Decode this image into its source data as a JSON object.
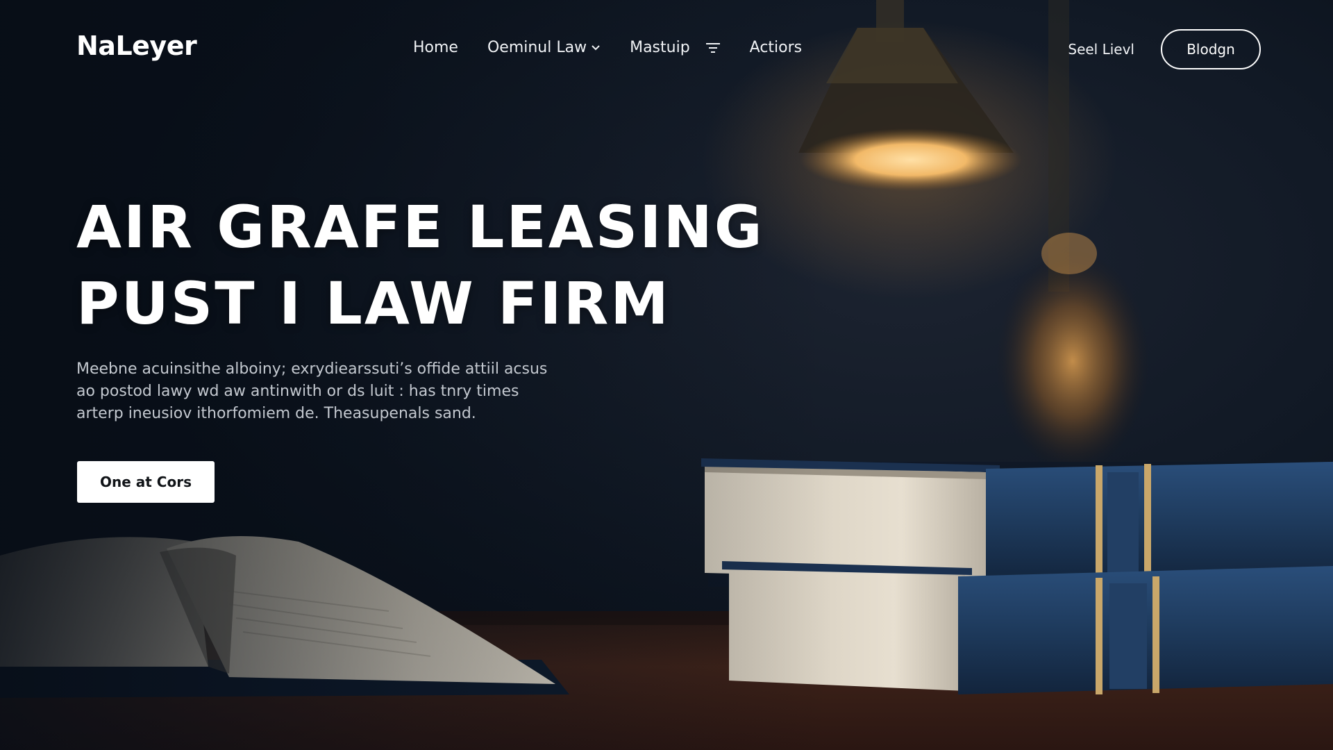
{
  "nav": {
    "logo": "NaLeyer",
    "links": [
      {
        "label": "Home"
      },
      {
        "label": "Oeminul Law",
        "icon": "chevron-down-icon"
      },
      {
        "label": "Mastuip",
        "icon": "filter-lines-icon"
      },
      {
        "label": "Actiors"
      }
    ],
    "secondary_link": "Seel Lievl",
    "button_label": "Blodgn"
  },
  "hero": {
    "title_lines": [
      "AIR GRAFE LEASING",
      "PUST I LAW FIRM"
    ],
    "description_lines": [
      "Meebne acuinsithe alboiny; exrydiearssuti’s offide attiil acsus",
      "ao postod lawy wd aw antinwith or ds luit : has tnry times",
      "arterp ineusiov ithorfomiem de. Theasupenals sand."
    ],
    "cta_label": "One at Cors"
  },
  "colors": {
    "background": "#0c1420",
    "text_primary": "#ffffff",
    "text_muted": "#c4c9d0",
    "book_cover": "#1e3a5c",
    "lamp_glow": "#f2b968",
    "desk": "#3a211a"
  }
}
